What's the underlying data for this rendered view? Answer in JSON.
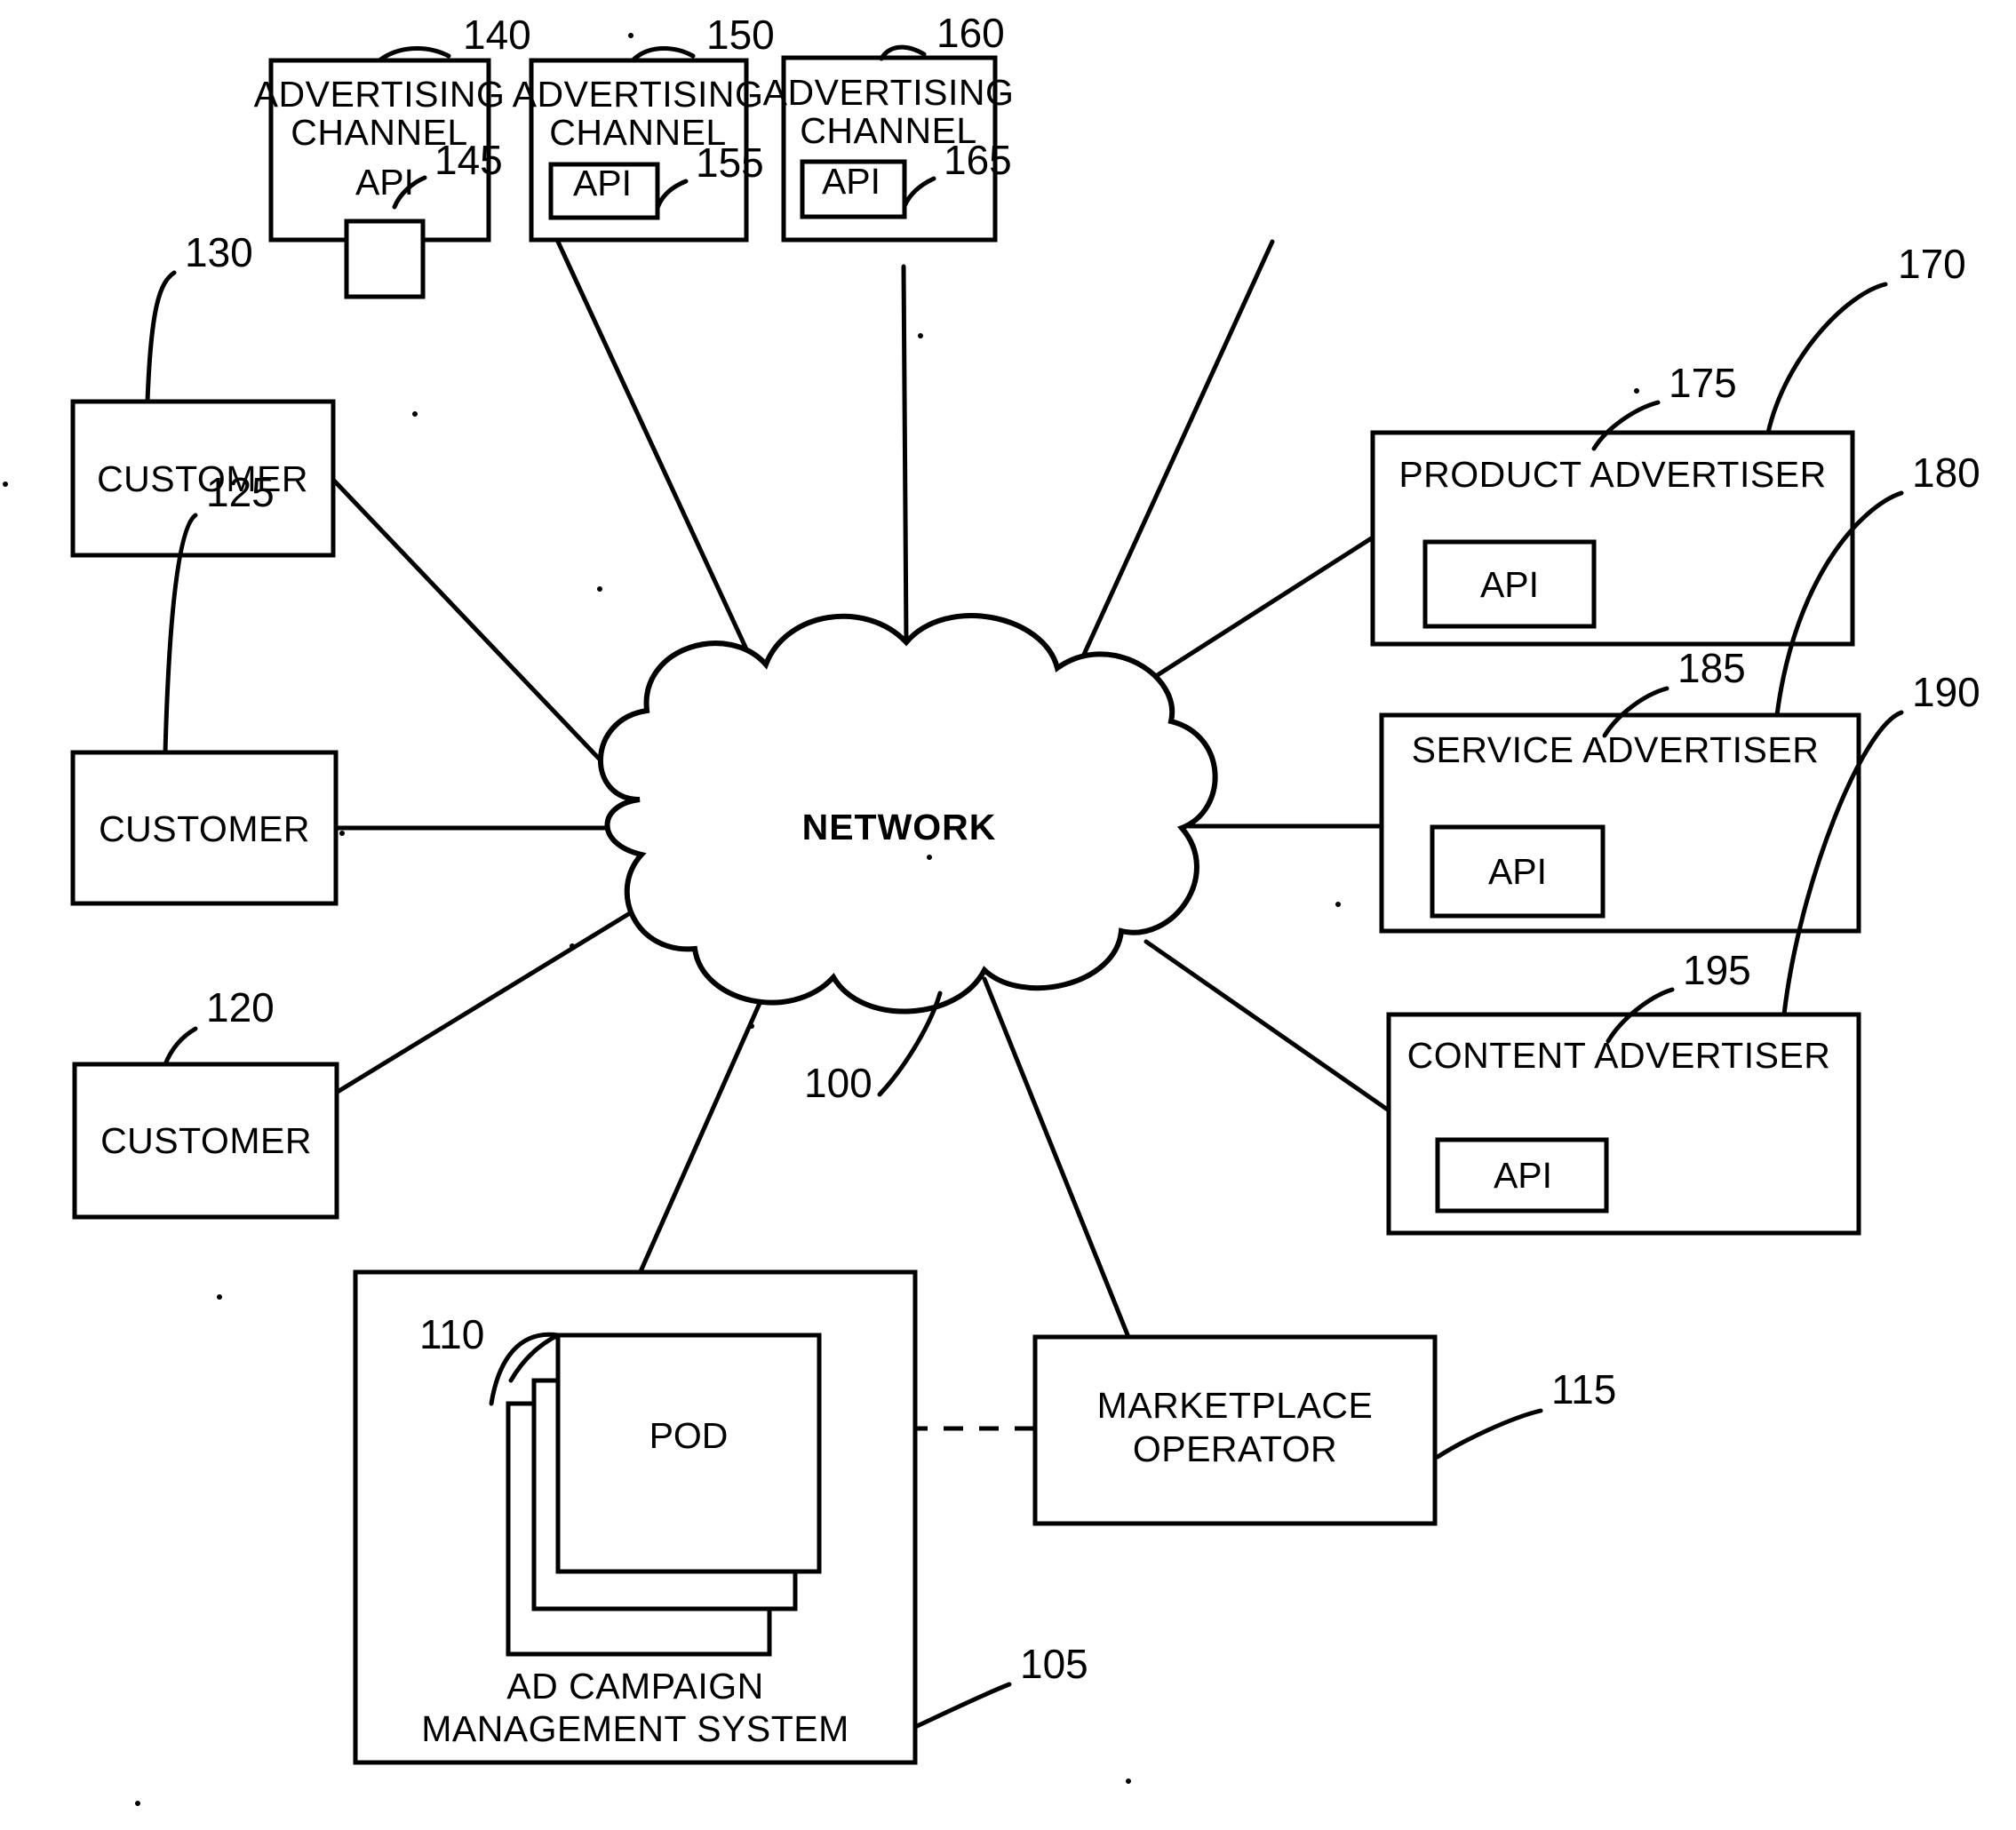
{
  "figure": {
    "type": "patent-block-diagram",
    "title": "",
    "system_ref": "100"
  },
  "nodes": {
    "ad_channel_1": {
      "label_line1": "ADVERTISING",
      "label_line2": "CHANNEL",
      "ref": "140",
      "api_label": "API",
      "api_ref": "145"
    },
    "ad_channel_2": {
      "label_line1": "ADVERTISING",
      "label_line2": "CHANNEL",
      "ref": "150",
      "api_label": "API",
      "api_ref": "155"
    },
    "ad_channel_3": {
      "label_line1": "ADVERTISING",
      "label_line2": "CHANNEL",
      "ref": "160",
      "api_label": "API",
      "api_ref": "165"
    },
    "customer_130": {
      "label": "CUSTOMER",
      "ref": "130"
    },
    "customer_125": {
      "label": "CUSTOMER",
      "ref": "125"
    },
    "customer_120": {
      "label": "CUSTOMER",
      "ref": "120"
    },
    "network": {
      "label": "NETWORK",
      "ref": "100"
    },
    "product_advertiser": {
      "label": "PRODUCT ADVERTISER",
      "ref": "170",
      "api_label": "API",
      "api_ref": "175"
    },
    "service_advertiser": {
      "label": "SERVICE ADVERTISER",
      "ref": "180",
      "api_label": "API",
      "api_ref": "185"
    },
    "content_advertiser": {
      "label": "CONTENT ADVERTISER",
      "ref": "190",
      "api_label": "API",
      "api_ref": "195"
    },
    "ad_campaign_system": {
      "label_line1": "AD CAMPAIGN",
      "label_line2": "MANAGEMENT SYSTEM",
      "ref": "105",
      "pod_label": "POD",
      "pod_ref": "110"
    },
    "marketplace_operator": {
      "label_line1": "MARKETPLACE",
      "label_line2": "OPERATOR",
      "ref": "115"
    }
  },
  "colors": {
    "ink": "#000000",
    "paper": "#ffffff"
  }
}
